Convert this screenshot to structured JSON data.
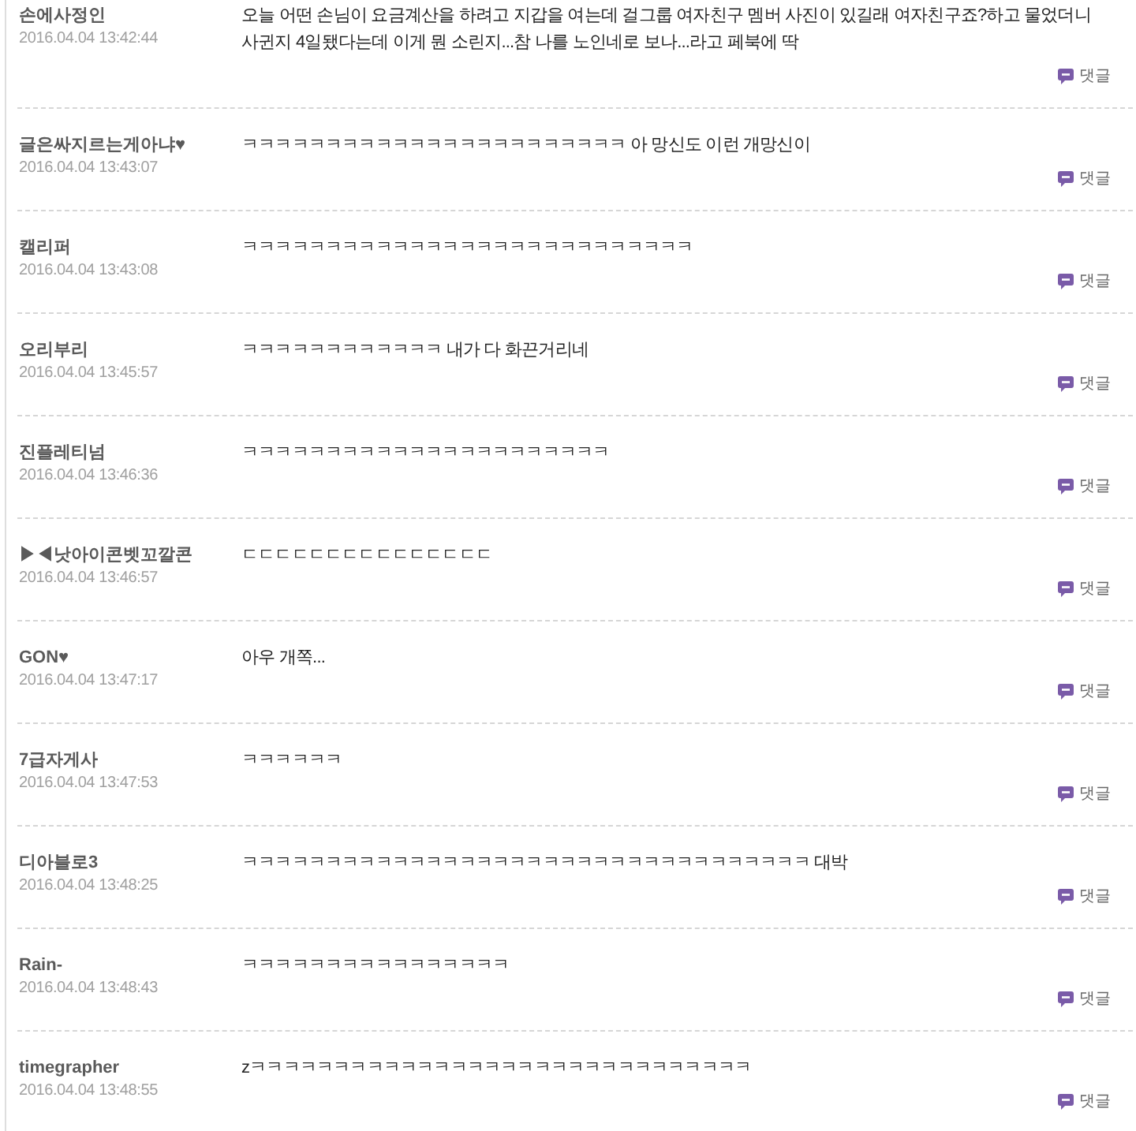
{
  "comments": [
    {
      "author": "손에사정인",
      "time": "2016.04.04 13:42:44",
      "text": "오늘 어떤 손님이 요금계산을 하려고 지갑을 여는데 걸그룹 여자친구 멤버 사진이 있길래 여자친구죠?하고 물었더니 사귄지 4일됐다는데 이게 뭔 소린지...참 나를 노인네로 보나...라고 페북에 딱",
      "reply_button": "댓글"
    },
    {
      "author": "글은싸지르는게아냐♥",
      "time": "2016.04.04 13:43:07",
      "text": "ㅋㅋㅋㅋㅋㅋㅋㅋㅋㅋㅋㅋㅋㅋㅋㅋㅋㅋㅋㅋㅋㅋㅋ 아 망신도 이런 개망신이",
      "reply_button": "댓글"
    },
    {
      "author": "캘리퍼",
      "time": "2016.04.04 13:43:08",
      "text": "ㅋㅋㅋㅋㅋㅋㅋㅋㅋㅋㅋㅋㅋㅋㅋㅋㅋㅋㅋㅋㅋㅋㅋㅋㅋㅋㅋ",
      "reply_button": "댓글"
    },
    {
      "author": "오리부리",
      "time": "2016.04.04 13:45:57",
      "text": "ㅋㅋㅋㅋㅋㅋㅋㅋㅋㅋㅋㅋ 내가 다 화끈거리네",
      "reply_button": "댓글"
    },
    {
      "author": "진플레티넘",
      "time": "2016.04.04 13:46:36",
      "text": "ㅋㅋㅋㅋㅋㅋㅋㅋㅋㅋㅋㅋㅋㅋㅋㅋㅋㅋㅋㅋㅋㅋ",
      "reply_button": "댓글"
    },
    {
      "author": "▶◀낫아이콘벳꼬깔콘",
      "time": "2016.04.04 13:46:57",
      "text": "ㄷㄷㄷㄷㄷㄷㄷㄷㄷㄷㄷㄷㄷㄷㄷ",
      "reply_button": "댓글"
    },
    {
      "author": "GON♥",
      "time": "2016.04.04 13:47:17",
      "text": "아우 개쪽...",
      "reply_button": "댓글"
    },
    {
      "author": "7급자게사",
      "time": "2016.04.04 13:47:53",
      "text": "ㅋㅋㅋㅋㅋㅋ",
      "reply_button": "댓글"
    },
    {
      "author": "디아블로3",
      "time": "2016.04.04 13:48:25",
      "text": "ㅋㅋㅋㅋㅋㅋㅋㅋㅋㅋㅋㅋㅋㅋㅋㅋㅋㅋㅋㅋㅋㅋㅋㅋㅋㅋㅋㅋㅋㅋㅋㅋㅋㅋ 대박",
      "reply_button": "댓글"
    },
    {
      "author": "Rain-",
      "time": "2016.04.04 13:48:43",
      "text": "ㅋㅋㅋㅋㅋㅋㅋㅋㅋㅋㅋㅋㅋㅋㅋㅋ",
      "reply_button": "댓글"
    },
    {
      "author": "timegrapher",
      "time": "2016.04.04 13:48:55",
      "text": "zㅋㅋㅋㅋㅋㅋㅋㅋㅋㅋㅋㅋㅋㅋㅋㅋㅋㅋㅋㅋㅋㅋㅋㅋㅋㅋㅋㅋㅋㅋ",
      "reply_button": "댓글"
    }
  ]
}
